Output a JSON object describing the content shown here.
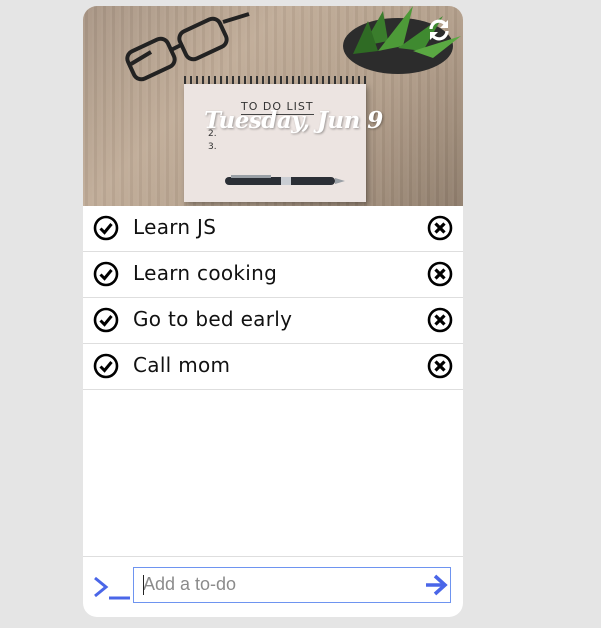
{
  "header": {
    "date": "Tuesday, Jun 9",
    "notepad_title": "TO DO LIST",
    "notepad_numbers": [
      "2.",
      "3."
    ],
    "refresh_icon": "refresh-icon"
  },
  "todos": [
    {
      "text": "Learn JS",
      "check_icon": "check-circle-icon",
      "delete_icon": "close-circle-icon"
    },
    {
      "text": "Learn cooking",
      "check_icon": "check-circle-icon",
      "delete_icon": "close-circle-icon"
    },
    {
      "text": "Go to bed early",
      "check_icon": "check-circle-icon",
      "delete_icon": "close-circle-icon"
    },
    {
      "text": "Call mom",
      "check_icon": "check-circle-icon",
      "delete_icon": "close-circle-icon"
    }
  ],
  "input": {
    "placeholder": "Add a to-do",
    "value": "",
    "prompt_icon": "terminal-prompt-icon",
    "submit_icon": "arrow-right-icon"
  },
  "colors": {
    "accent": "#4a66e8",
    "background": "#e5e5e5",
    "card": "#ffffff"
  }
}
